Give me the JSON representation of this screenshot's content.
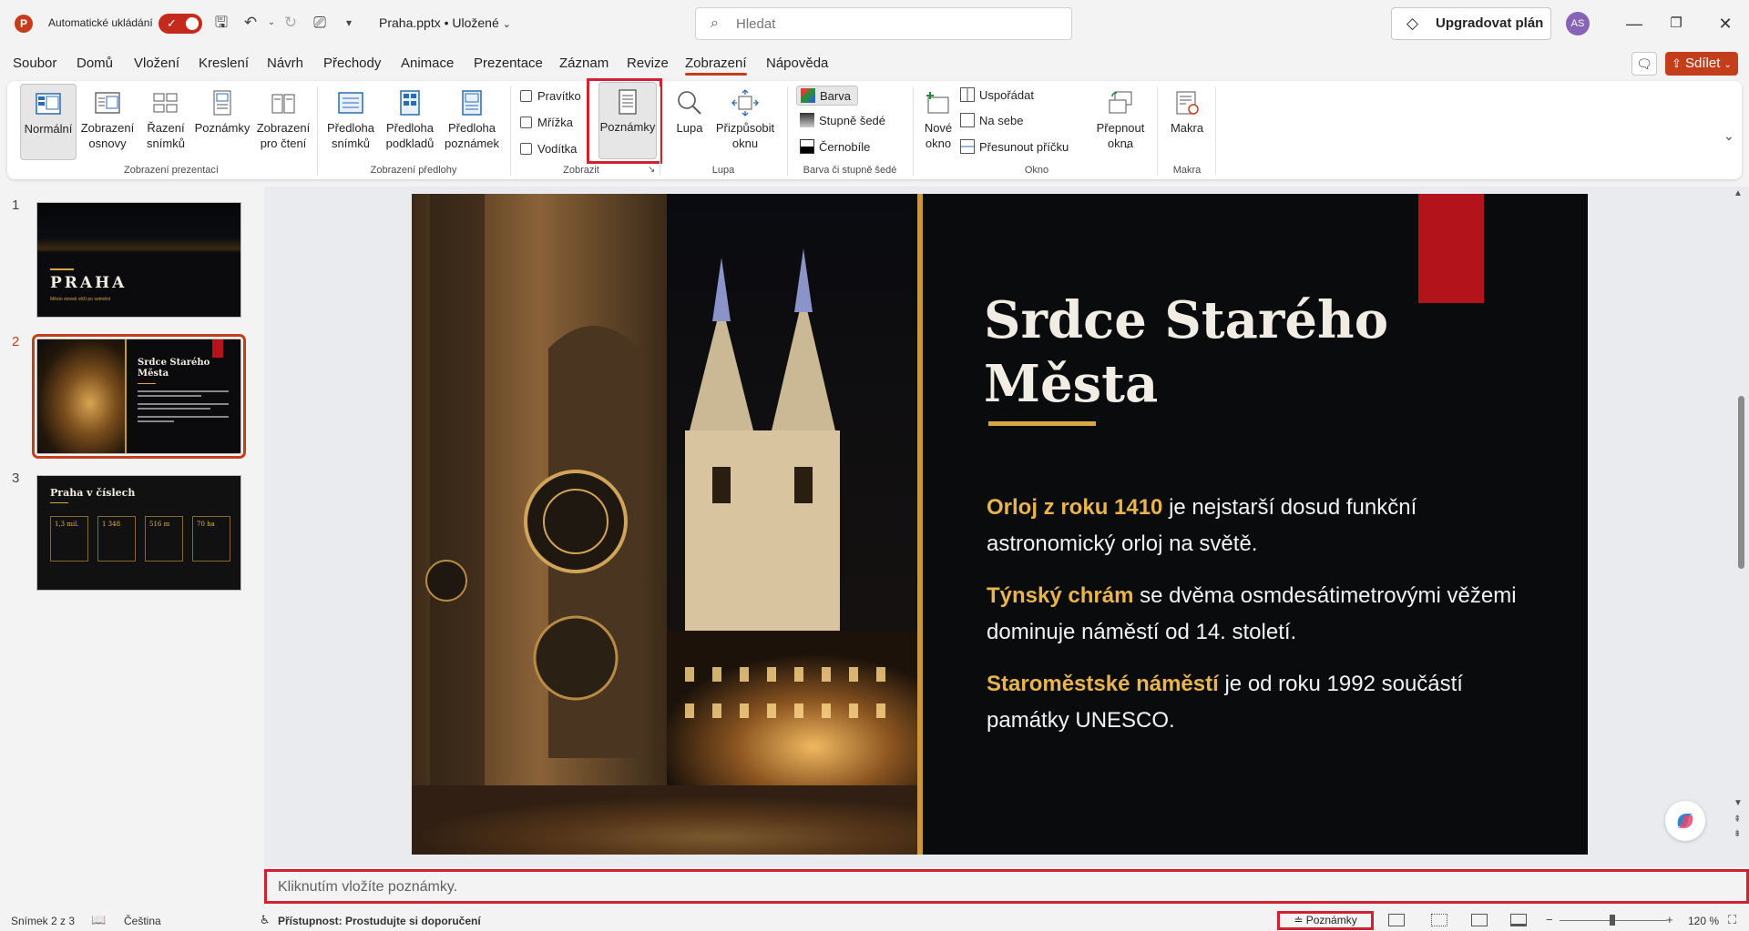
{
  "titlebar": {
    "app_logo": "P",
    "autosave_label": "Automatické ukládání",
    "file_name": "Praha.pptx • Uložené",
    "search_placeholder": "Hledat",
    "upgrade_label": "Upgradovat plán",
    "avatar_initials": "AS"
  },
  "menu": {
    "tabs": [
      "Soubor",
      "Domů",
      "Vložení",
      "Kreslení",
      "Návrh",
      "Přechody",
      "Animace",
      "Prezentace",
      "Záznam",
      "Revize",
      "Zobrazení",
      "Nápověda"
    ],
    "active_tab": "Zobrazení",
    "share_label": "Sdílet"
  },
  "ribbon": {
    "presentation_views": {
      "label": "Zobrazení prezentací",
      "buttons": [
        "Normální",
        "Zobrazení osnovy",
        "Řazení snímků",
        "Poznámky",
        "Zobrazení pro čtení"
      ]
    },
    "master_views": {
      "label": "Zobrazení předlohy",
      "buttons": [
        "Předloha snímků",
        "Předloha podkladů",
        "Předloha poznámek"
      ]
    },
    "show": {
      "label": "Zobrazit",
      "checkboxes": [
        "Pravítko",
        "Mřížka",
        "Vodítka"
      ],
      "notes_button": "Poznámky"
    },
    "zoom": {
      "label": "Lupa",
      "buttons": [
        "Lupa",
        "Přizpůsobit oknu"
      ]
    },
    "color": {
      "label": "Barva či stupně šedé",
      "options": [
        "Barva",
        "Stupně šedé",
        "Černobíle"
      ]
    },
    "window": {
      "label": "Okno",
      "new_window": "Nové okno",
      "options": [
        "Uspořádat",
        "Na sebe",
        "Přesunout příčku"
      ],
      "switch_windows": "Přepnout okna"
    },
    "macros": {
      "label": "Makra",
      "button": "Makra"
    }
  },
  "slides": [
    {
      "number": "1",
      "title": "PRAHA",
      "subtitle": "Město stovek věží po setmění"
    },
    {
      "number": "2",
      "title": "Srdce Starého Města"
    },
    {
      "number": "3",
      "title": "Praha v číslech",
      "stats": [
        "1,3 mil.",
        "1 348",
        "516 m",
        "70 ha"
      ]
    }
  ],
  "current_slide": {
    "title": "Srdce Starého Města",
    "paragraphs": [
      {
        "highlight": "Orloj z roku 1410",
        "text": " je nejstarší dosud funkční astronomický orloj na světě."
      },
      {
        "highlight": "Týnský chrám",
        "text": " se dvěma osmdesátimetrovými věžemi dominuje náměstí od 14. století."
      },
      {
        "highlight": "Staroměstské náměstí",
        "text": " je od roku 1992 součástí památky UNESCO."
      }
    ]
  },
  "notes_placeholder": "Kliknutím vložíte poznámky.",
  "statusbar": {
    "slide_counter": "Snímek 2 z 3",
    "language": "Čeština",
    "accessibility": "Přístupnost: Prostudujte si doporučení",
    "notes_button": "Poznámky",
    "zoom_level": "120 %"
  },
  "colors": {
    "accent": "#c43e1c",
    "highlight_box": "#d1202f",
    "slide_gold": "#e9b44c",
    "slide_red": "#b3141b"
  }
}
